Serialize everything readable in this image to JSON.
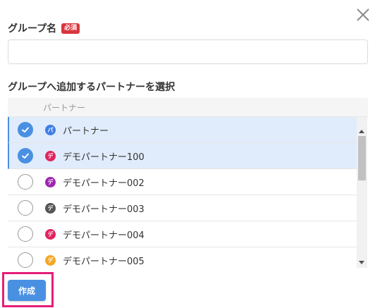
{
  "dialog": {
    "group_name_label": "グループ名",
    "required_badge": "必須",
    "group_name_value": "",
    "group_name_placeholder": "",
    "partner_section_label": "グループへ追加するパートナーを選択",
    "table_header": "パートナー",
    "create_label": "作成"
  },
  "partners": [
    {
      "name": "パートナー",
      "initial": "パ",
      "color": "#3f7de8",
      "selected": true
    },
    {
      "name": "デモパートナー100",
      "initial": "デ",
      "color": "#e0245e",
      "selected": true
    },
    {
      "name": "デモパートナー002",
      "initial": "デ",
      "color": "#9c27b0",
      "selected": false
    },
    {
      "name": "デモパートナー003",
      "initial": "デ",
      "color": "#555555",
      "selected": false
    },
    {
      "name": "デモパートナー004",
      "initial": "デ",
      "color": "#e0245e",
      "selected": false
    },
    {
      "name": "デモパートナー005",
      "initial": "デ",
      "color": "#f5a623",
      "selected": false
    }
  ],
  "colors": {
    "accent": "#4a90e2",
    "selected_row": "#e0ecfb",
    "required_badge": "#d9363e",
    "highlight": "#e61e78"
  }
}
